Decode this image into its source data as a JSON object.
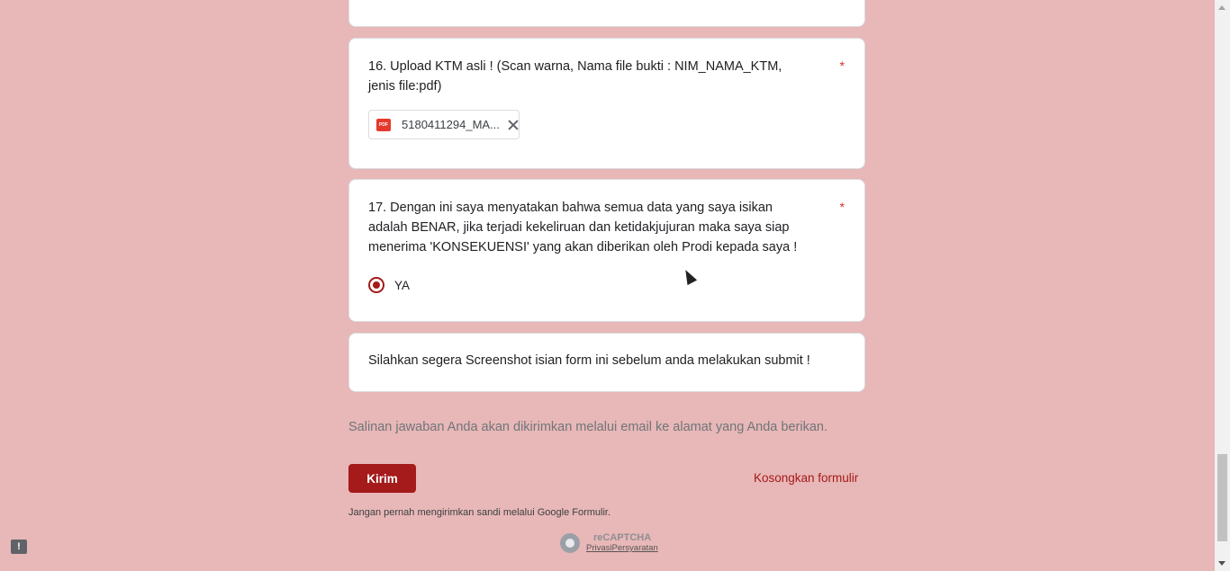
{
  "question16": {
    "title": "16. Upload KTM asli ! (Scan warna, Nama file bukti : NIM_NAMA_KTM, jenis file:pdf)",
    "required": "*",
    "file": {
      "icon": "pdf-icon",
      "icon_text": "PDF",
      "name": "5180411294_MA..."
    }
  },
  "question17": {
    "title": "17. Dengan ini saya menyatakan bahwa semua data yang saya isikan adalah BENAR, jika terjadi kekeliruan dan ketidakjujuran maka saya siap menerima 'KONSEKUENSI' yang akan diberikan oleh Prodi kepada saya !",
    "required": "*",
    "option": {
      "label": "YA",
      "selected": true
    }
  },
  "notice": {
    "text": "Silahkan segera Screenshot isian form ini sebelum anda melakukan submit !"
  },
  "footer": {
    "copy_note": "Salinan jawaban Anda akan dikirimkan melalui email ke alamat yang Anda berikan.",
    "submit_label": "Kirim",
    "clear_label": "Kosongkan formulir",
    "never_note": "Jangan pernah mengirimkan sandi melalui Google Formulir.",
    "recaptcha_title": "reCAPTCHA",
    "recaptcha_links": "PrivasiPersyaratan"
  },
  "feedback": {
    "icon": "feedback-icon",
    "text": "!"
  },
  "colors": {
    "background": "#e8b7b7",
    "accent": "#a51a1a",
    "required": "#d93025"
  }
}
